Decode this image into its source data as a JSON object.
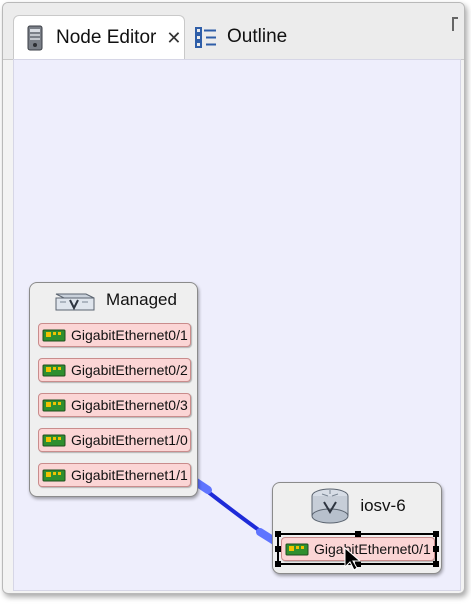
{
  "tabs": {
    "active": {
      "label": "Node Editor",
      "icon": "device-icon",
      "close": "close-tab-icon"
    },
    "inactive": {
      "label": "Outline",
      "icon": "outline-icon"
    }
  },
  "canvas": {
    "background": "#eeeefc",
    "nodes": [
      {
        "name": "Managed",
        "icon": "switch-icon",
        "interfaces": [
          "GigabitEthernet0/1",
          "GigabitEthernet0/2",
          "GigabitEthernet0/3",
          "GigabitEthernet1/0",
          "GigabitEthernet1/1"
        ]
      },
      {
        "name": "iosv-6",
        "icon": "router-icon",
        "interfaces": [
          "GigabitEthernet0/1"
        ]
      }
    ],
    "link": {
      "from": "Managed: GigabitEthernet1/1",
      "to": "iosv-6: GigabitEthernet0/1",
      "color": "#1e2bd8"
    }
  },
  "colors": {
    "interface_fill": "#fbd5d5",
    "node_fill": "#efefef",
    "selection": "#000000"
  }
}
